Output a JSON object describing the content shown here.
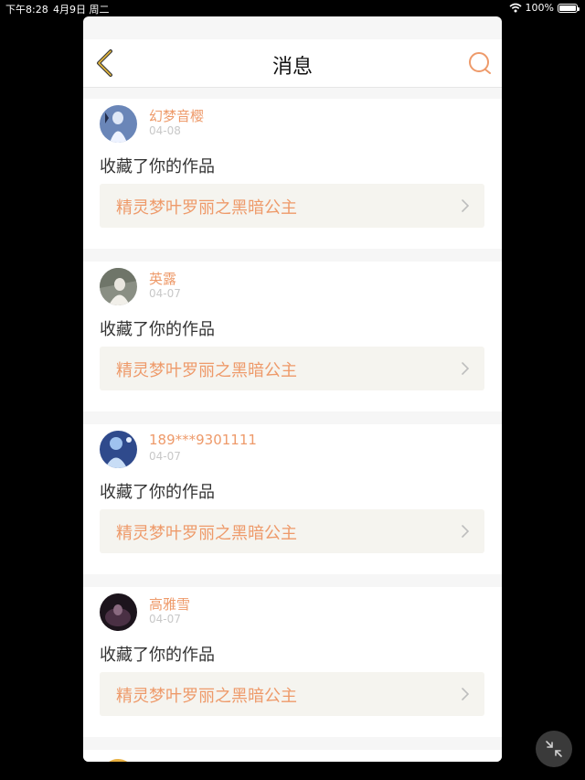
{
  "status": {
    "time": "下午8:28",
    "date": "4月9日 周二",
    "battery": "100%"
  },
  "nav": {
    "title": "消息"
  },
  "messages": [
    {
      "user": "幻梦音樱",
      "date": "04-08",
      "action": "收藏了你的作品",
      "work": "精灵梦叶罗丽之黑暗公主",
      "avatar_color": "#6a86b8"
    },
    {
      "user": "英露",
      "date": "04-07",
      "action": "收藏了你的作品",
      "work": "精灵梦叶罗丽之黑暗公主",
      "avatar_color": "#8a8f84"
    },
    {
      "user": "189***9301111",
      "date": "04-07",
      "action": "收藏了你的作品",
      "work": "精灵梦叶罗丽之黑暗公主",
      "avatar_color": "#2f4a8c"
    },
    {
      "user": "高雅雪",
      "date": "04-07",
      "action": "收藏了你的作品",
      "work": "精灵梦叶罗丽之黑暗公主",
      "avatar_color": "#3a2c38"
    }
  ],
  "accent_color": "#ee9a6a"
}
